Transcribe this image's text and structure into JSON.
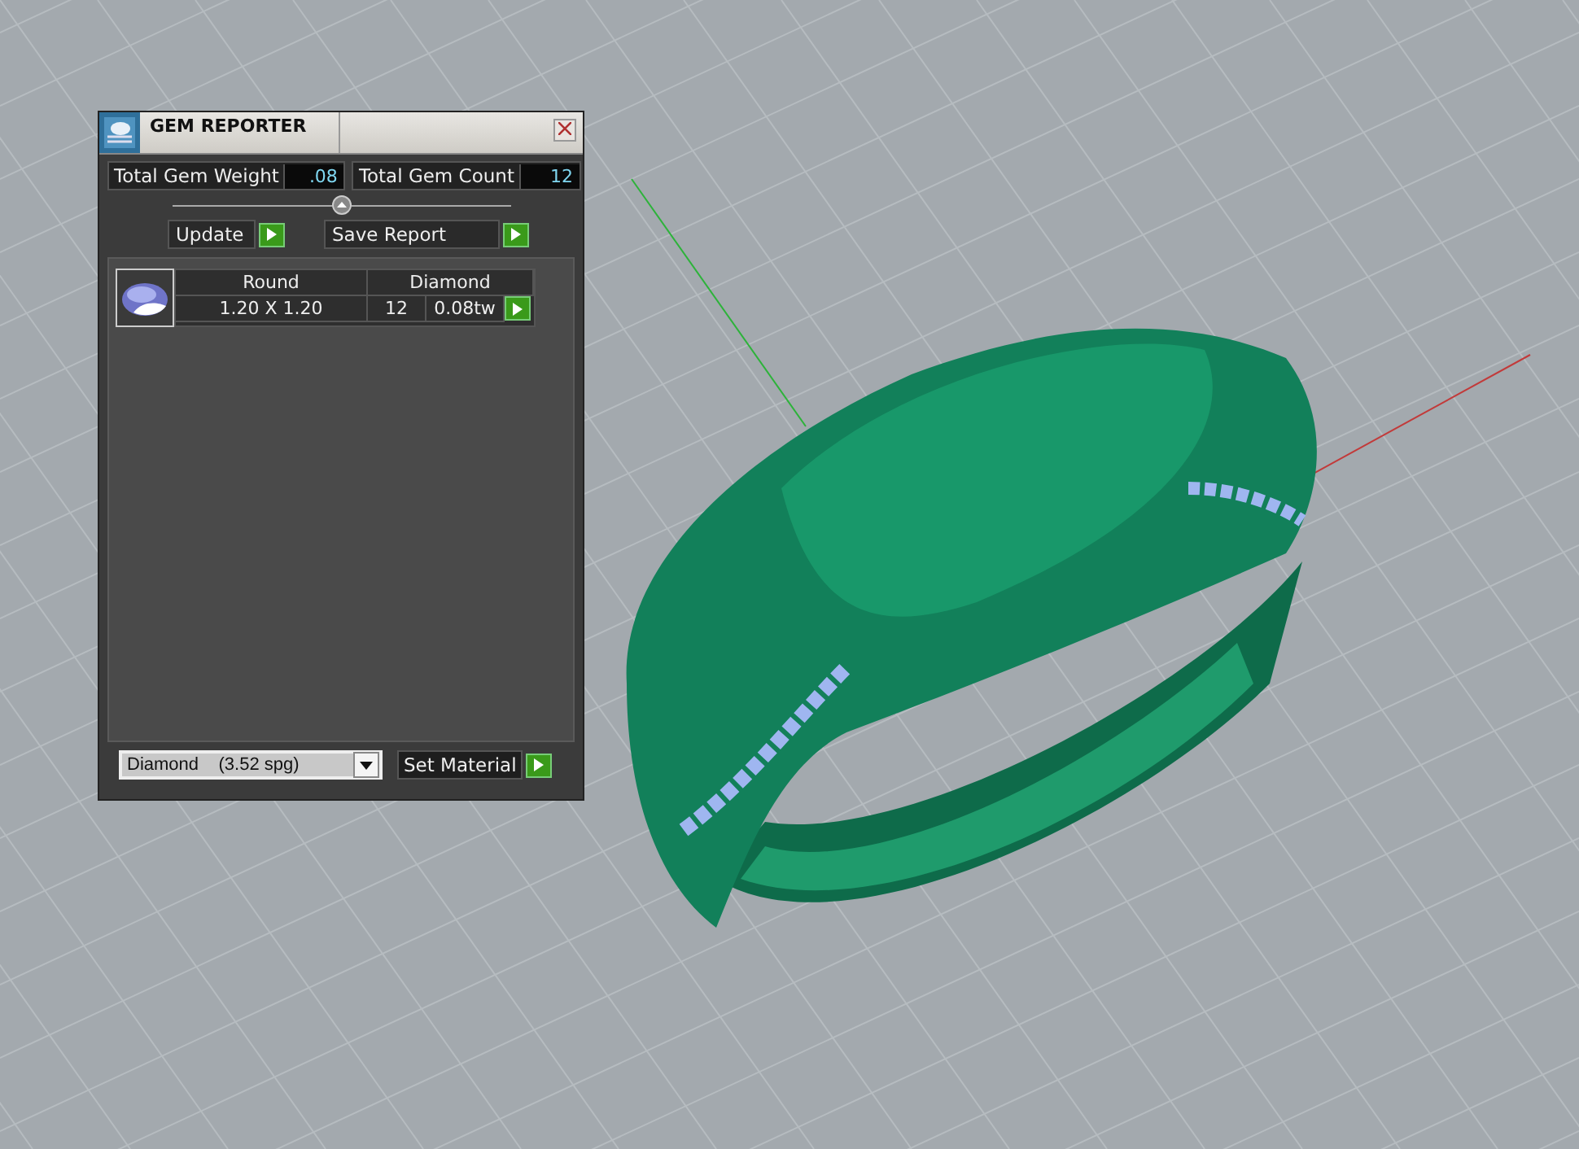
{
  "window": {
    "title": "GEM REPORTER"
  },
  "totals": [
    {
      "label": "Total Gem Weight",
      "value": ".08"
    },
    {
      "label": "Total Gem Count",
      "value": "12"
    }
  ],
  "actions": [
    {
      "label": "Update"
    },
    {
      "label": "Save Report"
    }
  ],
  "gems": [
    {
      "shape": "Round",
      "material": "Diamond",
      "size": "1.20 X 1.20",
      "count": "12",
      "weight": "0.08tw"
    }
  ],
  "material_select": {
    "value": "Diamond    (3.52 spg)"
  },
  "set_material": {
    "label": "Set Material"
  }
}
